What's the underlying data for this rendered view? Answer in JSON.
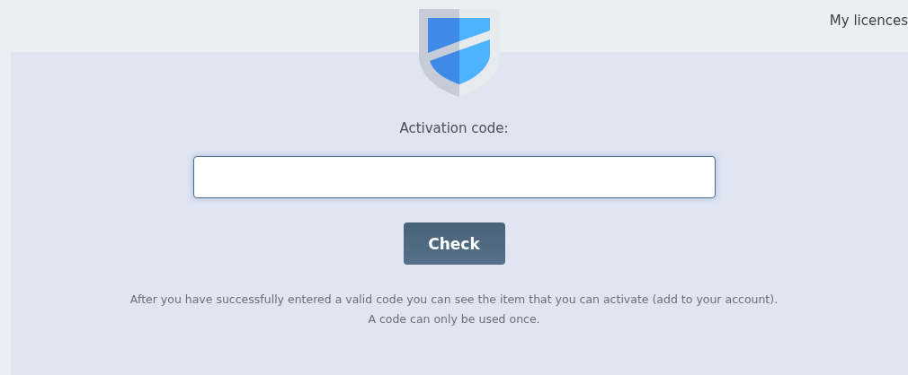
{
  "header": {
    "link": "My licences"
  },
  "form": {
    "label": "Activation code:",
    "button": "Check"
  },
  "help": [
    "After you have successfully entered a valid code you can see the item that you can activate (add to your account).",
    "A code can only be used once."
  ]
}
